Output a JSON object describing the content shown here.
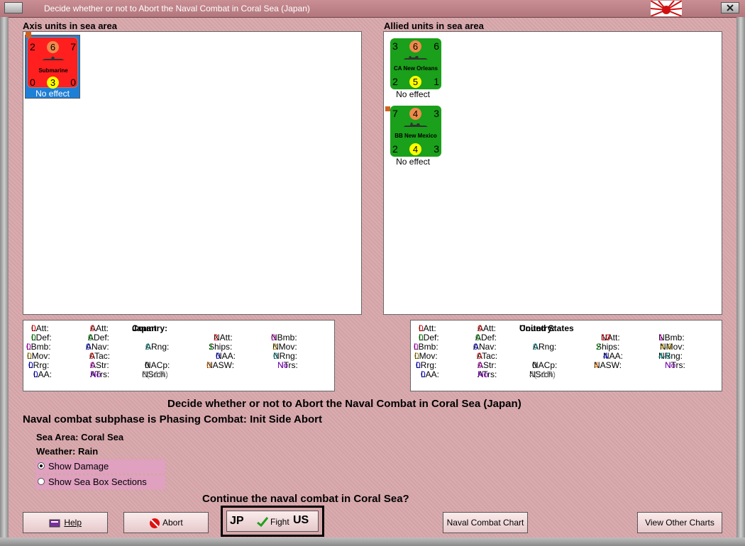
{
  "window": {
    "title": "Decide whether or not to Abort the Naval Combat in Coral Sea (Japan)"
  },
  "axis": {
    "label": "Axis units in sea area",
    "units": [
      {
        "top_left": "2",
        "top_mid": "6",
        "top_right": "7",
        "name": "Submarine",
        "bot_left": "0",
        "bot_mid": "3",
        "bot_right": "0",
        "effect": "No effect",
        "color": "#ff1f1f"
      }
    ]
  },
  "allied": {
    "label": "Allied units in sea area",
    "units": [
      {
        "top_left": "3",
        "top_mid": "6",
        "top_right": "6",
        "name": "CA New Orleans",
        "bot_left": "2",
        "bot_mid": "5",
        "bot_right": "1",
        "effect": "No effect",
        "color": "#1aa01a"
      },
      {
        "top_left": "7",
        "top_mid": "4",
        "top_right": "3",
        "name": "BB New Mexico",
        "bot_left": "2",
        "bot_mid": "4",
        "bot_right": "3",
        "effect": "No effect",
        "color": "#1aa01a"
      }
    ]
  },
  "axis_stats": {
    "country_label": "Country:",
    "country": "Japan",
    "LAtt": "0",
    "LDef": "0",
    "LBmb": "0",
    "LMov": "0",
    "LRrg": "0",
    "LAA": "0",
    "AAtt": "0",
    "ADef": "0",
    "ANav": "0",
    "ATac": "0",
    "AStr": "0",
    "ATrs": "No",
    "ARng": "0",
    "NACp": "0",
    "NAtt": "2",
    "Ships": "1",
    "NAA": "0",
    "NASW": "0",
    "NSrch": "3(+1R)",
    "NBmb": "0",
    "NMov": "3",
    "NRng": "0",
    "NTrs": "No"
  },
  "allied_stats": {
    "country_label": "Country:",
    "country": "United States",
    "LAtt": "0",
    "LDef": "0",
    "LBmb": "0",
    "LMov": "0",
    "LRrg": "0",
    "LAA": "0",
    "AAtt": "0",
    "ADef": "0",
    "ANav": "0",
    "ATac": "0",
    "AStr": "0",
    "ATrs": "No",
    "ARng": "0",
    "NACp": "0",
    "NAtt": "10",
    "Ships": "2",
    "NAA": "4",
    "NASW": "4",
    "NSrch": "4(+1R)",
    "NBmb": "1",
    "NMov": "4-6",
    "NRng": "4-5",
    "NTrs": "No"
  },
  "stat_labels": {
    "LAtt": "LAtt:",
    "LDef": "LDef:",
    "LBmb": "LBmb:",
    "LMov": "LMov:",
    "LRrg": "LRrg:",
    "LAA": "LAA:",
    "AAtt": "AAtt:",
    "ADef": "ADef:",
    "ANav": "ANav:",
    "ATac": "ATac:",
    "AStr": "AStr:",
    "ATrs": "ATrs:",
    "ARng": "ARng:",
    "NACp": "NACp:",
    "NAtt": "NAtt:",
    "Ships": "Ships:",
    "NAA": "NAA:",
    "NASW": "NASW:",
    "NSrch": "NSrch:",
    "NBmb": "NBmb:",
    "NMov": "NMov:",
    "NRng": "NRng:",
    "NTrs": "NTrs:"
  },
  "main": {
    "heading": "Decide whether or not to Abort the Naval Combat in Coral Sea (Japan)",
    "subphase": "Naval combat subphase is Phasing Combat: Init Side Abort",
    "sea_area_label": "Sea Area:",
    "sea_area": "Coral Sea",
    "weather_label": "Weather:",
    "weather": "Rain",
    "show_damage": "Show Damage",
    "show_sea_box": "Show Sea Box Sections",
    "question": "Continue the naval combat in Coral Sea?"
  },
  "buttons": {
    "help": "Help",
    "abort": "Abort",
    "fight_left": "JP",
    "fight": "Fight",
    "fight_right": "US",
    "naval_chart": "Naval Combat Chart",
    "view_other": "View Other Charts"
  }
}
